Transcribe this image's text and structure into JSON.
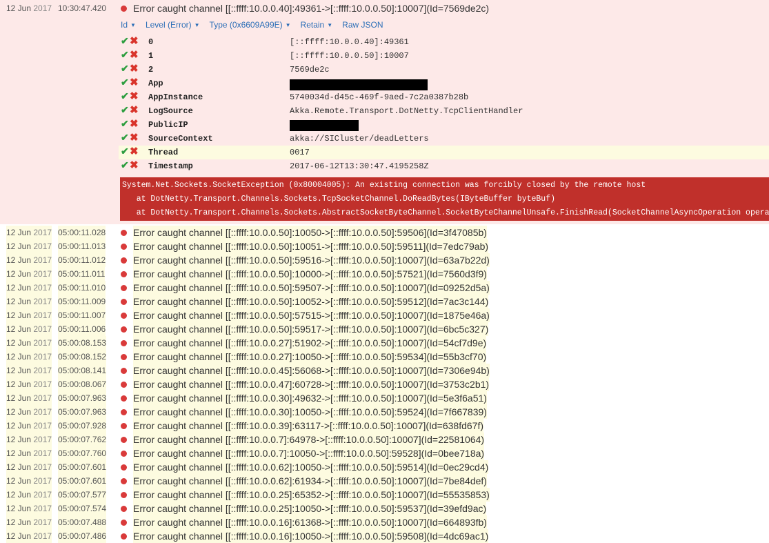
{
  "expanded": {
    "date": "12 Jun",
    "year": "2017",
    "time": "10:30:47.420",
    "message": "Error caught channel [[::ffff:10.0.0.40]:49361->[::ffff:10.0.0.50]:10007](Id=7569de2c)",
    "actions": [
      {
        "label": "Id",
        "has_caret": true
      },
      {
        "label": "Level (Error)",
        "has_caret": true
      },
      {
        "label": "Type (0x6609A99E)",
        "has_caret": true
      },
      {
        "label": "Retain",
        "has_caret": true
      },
      {
        "label": "Raw JSON",
        "has_caret": false
      }
    ],
    "include_icon": "✔",
    "exclude_icon": "✖",
    "properties": [
      {
        "name": "0",
        "value": "[::ffff:10.0.0.40]:49361"
      },
      {
        "name": "1",
        "value": "[::ffff:10.0.0.50]:10007"
      },
      {
        "name": "2",
        "value": "7569de2c"
      },
      {
        "name": "App",
        "value": "",
        "redacted": true
      },
      {
        "name": "AppInstance",
        "value": "5740034d-d45c-469f-9aed-7c2a0387b28b"
      },
      {
        "name": "LogSource",
        "value": "Akka.Remote.Transport.DotNetty.TcpClientHandler"
      },
      {
        "name": "PublicIP",
        "value": "",
        "redacted": true
      },
      {
        "name": "SourceContext",
        "value": "akka://SICluster/deadLetters"
      },
      {
        "name": "Thread",
        "value": "0017",
        "highlight": true
      },
      {
        "name": "Timestamp",
        "value": "2017-06-12T13:30:47.4195258Z"
      }
    ],
    "exception": [
      "System.Net.Sockets.SocketException (0x80004005): An existing connection was forcibly closed by the remote host",
      "   at DotNetty.Transport.Channels.Sockets.TcpSocketChannel.DoReadBytes(IByteBuffer byteBuf)",
      "   at DotNetty.Transport.Channels.Sockets.AbstractSocketByteChannel.SocketByteChannelUnsafe.FinishRead(SocketChannelAsyncOperation operation)"
    ]
  },
  "colors": {
    "expanded_bg": "#fde9e8",
    "exception_bg": "#c0302b",
    "highlight_bg": "#fdfbe0",
    "level_dot": "#d93a3a",
    "link": "#2d6fb7"
  },
  "events": [
    {
      "date": "12 Jun",
      "year": "2017",
      "time": "05:00:11.028",
      "message": "Error caught channel [[::ffff:10.0.0.50]:10050->[::ffff:10.0.0.50]:59506](Id=3f47085b)"
    },
    {
      "date": "12 Jun",
      "year": "2017",
      "time": "05:00:11.013",
      "message": "Error caught channel [[::ffff:10.0.0.50]:10051->[::ffff:10.0.0.50]:59511](Id=7edc79ab)"
    },
    {
      "date": "12 Jun",
      "year": "2017",
      "time": "05:00:11.012",
      "message": "Error caught channel [[::ffff:10.0.0.50]:59516->[::ffff:10.0.0.50]:10007](Id=63a7b22d)"
    },
    {
      "date": "12 Jun",
      "year": "2017",
      "time": "05:00:11.011",
      "message": "Error caught channel [[::ffff:10.0.0.50]:10000->[::ffff:10.0.0.50]:57521](Id=7560d3f9)"
    },
    {
      "date": "12 Jun",
      "year": "2017",
      "time": "05:00:11.010",
      "message": "Error caught channel [[::ffff:10.0.0.50]:59507->[::ffff:10.0.0.50]:10007](Id=09252d5a)"
    },
    {
      "date": "12 Jun",
      "year": "2017",
      "time": "05:00:11.009",
      "message": "Error caught channel [[::ffff:10.0.0.50]:10052->[::ffff:10.0.0.50]:59512](Id=7ac3c144)"
    },
    {
      "date": "12 Jun",
      "year": "2017",
      "time": "05:00:11.007",
      "message": "Error caught channel [[::ffff:10.0.0.50]:57515->[::ffff:10.0.0.50]:10007](Id=1875e46a)"
    },
    {
      "date": "12 Jun",
      "year": "2017",
      "time": "05:00:11.006",
      "message": "Error caught channel [[::ffff:10.0.0.50]:59517->[::ffff:10.0.0.50]:10007](Id=6bc5c327)"
    },
    {
      "date": "12 Jun",
      "year": "2017",
      "time": "05:00:08.153",
      "message": "Error caught channel [[::ffff:10.0.0.27]:51902->[::ffff:10.0.0.50]:10007](Id=54cf7d9e)"
    },
    {
      "date": "12 Jun",
      "year": "2017",
      "time": "05:00:08.152",
      "message": "Error caught channel [[::ffff:10.0.0.27]:10050->[::ffff:10.0.0.50]:59534](Id=55b3cf70)"
    },
    {
      "date": "12 Jun",
      "year": "2017",
      "time": "05:00:08.141",
      "message": "Error caught channel [[::ffff:10.0.0.45]:56068->[::ffff:10.0.0.50]:10007](Id=7306e94b)"
    },
    {
      "date": "12 Jun",
      "year": "2017",
      "time": "05:00:08.067",
      "message": "Error caught channel [[::ffff:10.0.0.47]:60728->[::ffff:10.0.0.50]:10007](Id=3753c2b1)"
    },
    {
      "date": "12 Jun",
      "year": "2017",
      "time": "05:00:07.963",
      "message": "Error caught channel [[::ffff:10.0.0.30]:49632->[::ffff:10.0.0.50]:10007](Id=5e3f6a51)"
    },
    {
      "date": "12 Jun",
      "year": "2017",
      "time": "05:00:07.963",
      "message": "Error caught channel [[::ffff:10.0.0.30]:10050->[::ffff:10.0.0.50]:59524](Id=7f667839)"
    },
    {
      "date": "12 Jun",
      "year": "2017",
      "time": "05:00:07.928",
      "message": "Error caught channel [[::ffff:10.0.0.39]:63117->[::ffff:10.0.0.50]:10007](Id=638fd67f)"
    },
    {
      "date": "12 Jun",
      "year": "2017",
      "time": "05:00:07.762",
      "message": "Error caught channel [[::ffff:10.0.0.7]:64978->[::ffff:10.0.0.50]:10007](Id=22581064)"
    },
    {
      "date": "12 Jun",
      "year": "2017",
      "time": "05:00:07.760",
      "message": "Error caught channel [[::ffff:10.0.0.7]:10050->[::ffff:10.0.0.50]:59528](Id=0bee718a)"
    },
    {
      "date": "12 Jun",
      "year": "2017",
      "time": "05:00:07.601",
      "message": "Error caught channel [[::ffff:10.0.0.62]:10050->[::ffff:10.0.0.50]:59514](Id=0ec29cd4)"
    },
    {
      "date": "12 Jun",
      "year": "2017",
      "time": "05:00:07.601",
      "message": "Error caught channel [[::ffff:10.0.0.62]:61934->[::ffff:10.0.0.50]:10007](Id=7be84def)"
    },
    {
      "date": "12 Jun",
      "year": "2017",
      "time": "05:00:07.577",
      "message": "Error caught channel [[::ffff:10.0.0.25]:65352->[::ffff:10.0.0.50]:10007](Id=55535853)"
    },
    {
      "date": "12 Jun",
      "year": "2017",
      "time": "05:00:07.574",
      "message": "Error caught channel [[::ffff:10.0.0.25]:10050->[::ffff:10.0.0.50]:59537](Id=39efd9ac)"
    },
    {
      "date": "12 Jun",
      "year": "2017",
      "time": "05:00:07.488",
      "message": "Error caught channel [[::ffff:10.0.0.16]:61368->[::ffff:10.0.0.50]:10007](Id=664893fb)"
    },
    {
      "date": "12 Jun",
      "year": "2017",
      "time": "05:00:07.486",
      "message": "Error caught channel [[::ffff:10.0.0.16]:10050->[::ffff:10.0.0.50]:59508](Id=4dc69ac1)"
    }
  ]
}
